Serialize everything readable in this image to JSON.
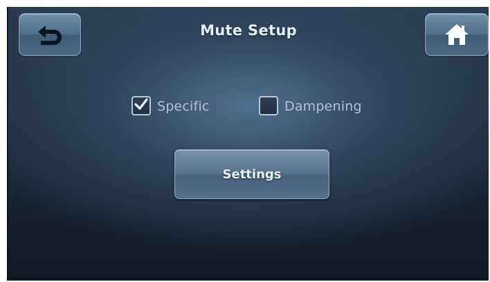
{
  "screen": {
    "title": "Mute Setup"
  },
  "nav": {
    "back_icon": "back-arrow-icon",
    "home_icon": "home-icon"
  },
  "options": [
    {
      "label": "Specific",
      "checked": true
    },
    {
      "label": "Dampening",
      "checked": false
    }
  ],
  "settings_button": {
    "label": "Settings"
  },
  "colors": {
    "background_top": "#2a3b4f",
    "background_bottom": "#111821",
    "button_face": "#5a7590",
    "text": "#e3edf6"
  }
}
